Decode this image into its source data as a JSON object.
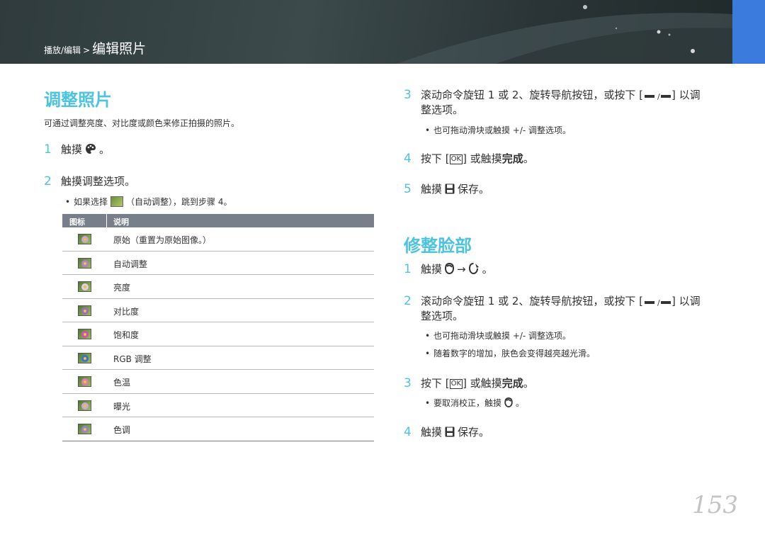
{
  "header": {
    "breadcrumb_parent": "播放/编辑",
    "breadcrumb_sep": ">",
    "breadcrumb_current": "编辑照片"
  },
  "left": {
    "title": "调整照片",
    "intro": "可通过调整亮度、对比度或颜色来修正拍摄的照片。",
    "step1": {
      "num": "1",
      "text_before": "触摸",
      "text_after": "。"
    },
    "step2": {
      "num": "2",
      "text": "触摸调整选项。"
    },
    "bullet1": {
      "dot": "•",
      "before": "如果选择",
      "after": "（自动调整），跳到步骤 4。"
    },
    "table": {
      "col_icon": "图标",
      "col_desc": "说明",
      "rows": [
        {
          "desc": "原始（重置为原始图像。）",
          "tint": "#c9a3d9"
        },
        {
          "desc": "自动调整",
          "tint": "#b87bd8"
        },
        {
          "desc": "亮度",
          "tint": "#e6c9ef"
        },
        {
          "desc": "对比度",
          "tint": "#a46ac8"
        },
        {
          "desc": "饱和度",
          "tint": "#d04fb9"
        },
        {
          "desc": "RGB 调整",
          "tint": "#3d6fd6"
        },
        {
          "desc": "色温",
          "tint": "#e57ab9"
        },
        {
          "desc": "曝光",
          "tint": "#cfa4e0"
        },
        {
          "desc": "色调",
          "tint": "#9a7fdc"
        }
      ]
    }
  },
  "right": {
    "step3": {
      "num": "3",
      "line1_before": "滚动命令旋钮 1 或 2、旋转导航按钮，或按下 [",
      "line1_after": "] 以调",
      "line2": "整选项。"
    },
    "step3_bullet": {
      "dot": "•",
      "text": "也可拖动滑块或触摸 +/- 调整选项。"
    },
    "step4": {
      "num": "4",
      "before": "按下 [",
      "after": "] 或触摸",
      "bold": "完成",
      "end": "。"
    },
    "step5": {
      "num": "5",
      "before": "触摸",
      "after": "保存。"
    },
    "title2": "修整脸部",
    "f_step1": {
      "num": "1",
      "before": "触摸",
      "arrow": "→",
      "end": "。"
    },
    "f_step2": {
      "num": "2",
      "line1_before": "滚动命令旋钮 1 或 2、旋转导航按钮，或按下 [",
      "line1_after": "] 以调",
      "line2": "整选项。"
    },
    "f_bullet1": {
      "dot": "•",
      "text": "也可拖动滑块或触摸 +/- 调整选项。"
    },
    "f_bullet2": {
      "dot": "•",
      "text": "随着数字的增加，肤色会变得越亮越光滑。"
    },
    "f_step3": {
      "num": "3",
      "before": "按下 [",
      "after": "] 或触摸",
      "bold": "完成",
      "end": "。"
    },
    "f_step3_bullet": {
      "dot": "•",
      "before": "要取消校正，触摸",
      "end": "。"
    },
    "f_step4": {
      "num": "4",
      "before": "触摸",
      "after": "保存。"
    }
  },
  "page_number": "153",
  "colors": {
    "accent": "#4cc4df",
    "tab": "#3b7bde"
  }
}
